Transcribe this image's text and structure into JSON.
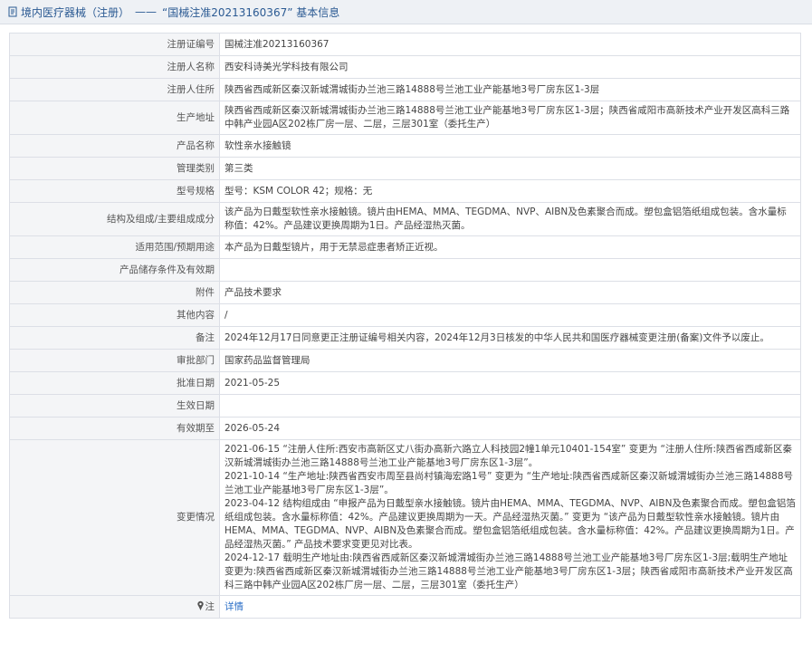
{
  "header": {
    "breadcrumb": "境内医疗器械（注册）",
    "separator": "——",
    "title": "“国械注准20213160367” 基本信息"
  },
  "rows": [
    {
      "label": "注册证编号",
      "value": "国械注准20213160367"
    },
    {
      "label": "注册人名称",
      "value": "西安科诗美光学科技有限公司"
    },
    {
      "label": "注册人住所",
      "value": "陕西省西咸新区秦汉新城渭城街办兰池三路14888号兰池工业产能基地3号厂房东区1-3层"
    },
    {
      "label": "生产地址",
      "value": "陕西省西咸新区秦汉新城渭城街办兰池三路14888号兰池工业产能基地3号厂房东区1-3层；陕西省咸阳市高新技术产业开发区高科三路中韩产业园A区202栋厂房一层、二层，三层301室（委托生产）"
    },
    {
      "label": "产品名称",
      "value": "软性亲水接触镜"
    },
    {
      "label": "管理类别",
      "value": "第三类"
    },
    {
      "label": "型号规格",
      "value": "型号：KSM COLOR 42；规格：无"
    },
    {
      "label": "结构及组成/主要组成成分",
      "value": "该产品为日戴型软性亲水接触镜。镜片由HEMA、MMA、TEGDMA、NVP、AIBN及色素聚合而成。塑包盒铝箔纸组成包装。含水量标称值：42%。产品建议更换周期为1日。产品经湿热灭菌。"
    },
    {
      "label": "适用范围/预期用途",
      "value": "本产品为日戴型镜片，用于无禁忌症患者矫正近视。"
    },
    {
      "label": "产品储存条件及有效期",
      "value": ""
    },
    {
      "label": "附件",
      "value": "产品技术要求"
    },
    {
      "label": "其他内容",
      "value": "/"
    },
    {
      "label": "备注",
      "value": "2024年12月17日同意更正注册证编号相关内容，2024年12月3日核发的中华人民共和国医疗器械变更注册(备案)文件予以废止。"
    },
    {
      "label": "审批部门",
      "value": "国家药品监督管理局"
    },
    {
      "label": "批准日期",
      "value": "2021-05-25"
    },
    {
      "label": "生效日期",
      "value": ""
    },
    {
      "label": "有效期至",
      "value": "2026-05-24"
    }
  ],
  "changes": {
    "label": "变更情况",
    "items": [
      "2021-06-15 “注册人住所:西安市高新区丈八街办高新六路立人科技园2幢1单元10401-154室” 变更为 “注册人住所:陕西省西咸新区秦汉新城渭城街办兰池三路14888号兰池工业产能基地3号厂房东区1-3层”。",
      "2021-10-14 “生产地址:陕西省西安市周至县尚村镇海宏路1号” 变更为 “生产地址:陕西省西咸新区秦汉新城渭城街办兰池三路14888号兰池工业产能基地3号厂房东区1-3层”。",
      "2023-04-12 结构组成由 “申报产品为日戴型亲水接触镜。镜片由HEMA、MMA、TEGDMA、NVP、AIBN及色素聚合而成。塑包盒铝箔纸组成包装。含水量标称值：42%。产品建议更换周期为一天。产品经湿热灭菌。” 变更为 “该产品为日戴型软性亲水接触镜。镜片由HEMA、MMA、TEGDMA、NVP、AIBN及色素聚合而成。塑包盒铝箔纸组成包装。含水量标称值：42%。产品建议更换周期为1日。产品经湿热灭菌。” 产品技术要求变更见对比表。",
      "2024-12-17 载明生产地址由:陕西省西咸新区秦汉新城渭城街办兰池三路14888号兰池工业产能基地3号厂房东区1-3层;载明生产地址变更为:陕西省西咸新区秦汉新城渭城街办兰池三路14888号兰池工业产能基地3号厂房东区1-3层；陕西省咸阳市高新技术产业开发区高科三路中韩产业园A区202栋厂房一层、二层，三层301室（委托生产）"
    ]
  },
  "note": {
    "label": "注",
    "icon": "pin-icon",
    "link": "详情",
    "link_color": "#2b6fc7"
  },
  "colors": {
    "header_text": "#2b5a93",
    "label_bg": "#f4f5f7",
    "border": "#dcdfe6"
  }
}
